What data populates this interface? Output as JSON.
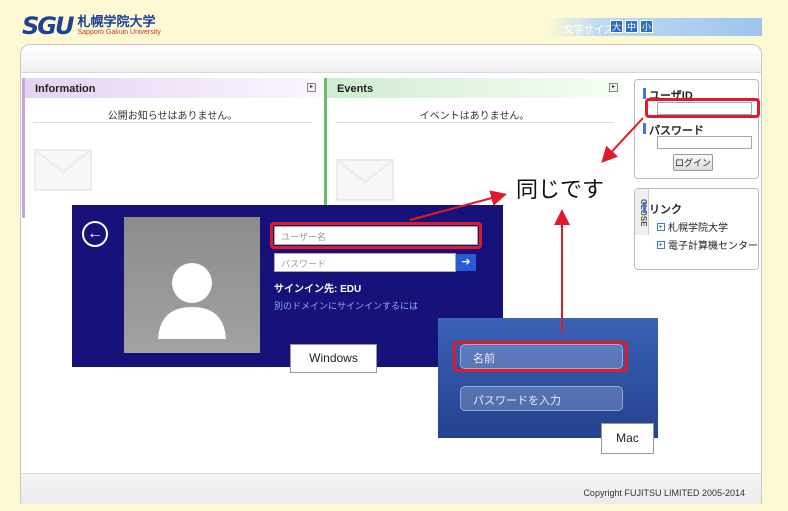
{
  "header": {
    "logo_mark": "SGU",
    "logo_jp": "札幌学院大学",
    "logo_en": "Sapporo Gakuin University",
    "font_size_label": "文字サイズ",
    "font_size_options": [
      "大",
      "中",
      "小"
    ]
  },
  "info_panel": {
    "title": "Information",
    "message": "公開お知らせはありません。",
    "menu_icon": "square-menu-icon"
  },
  "events_panel": {
    "title": "Events",
    "message": "イベントはありません。",
    "menu_icon": "square-menu-icon"
  },
  "login": {
    "user_id_label": "ユーザID",
    "password_label": "パスワード",
    "login_button": "ログイン"
  },
  "links": {
    "close_label": "CLOSE",
    "title": "リンク",
    "items": [
      "札幌学院大学",
      "電子計算機センター"
    ]
  },
  "annotation": {
    "same_label": "同じです",
    "highlight_color": "#e0192b"
  },
  "windows": {
    "username_placeholder": "ユーザー名",
    "password_placeholder": "パスワード",
    "signin_to": "サインイン先: EDU",
    "other_domain": "別のドメインにサインインするには",
    "tag": "Windows",
    "back_icon": "back-arrow-icon",
    "go_icon": "right-arrow-icon"
  },
  "mac": {
    "name_field": "名前",
    "password_field": "パスワードを入力",
    "tag": "Mac"
  },
  "footer": {
    "copyright": "Copyright FUJITSU LIMITED 2005-2014"
  },
  "colors": {
    "page_bg": "#fdf9d3",
    "accent_blue": "#1f3f9a",
    "windows_bg": "#17127a",
    "mac_bg": "#2f52a2",
    "highlight": "#e0192b"
  }
}
